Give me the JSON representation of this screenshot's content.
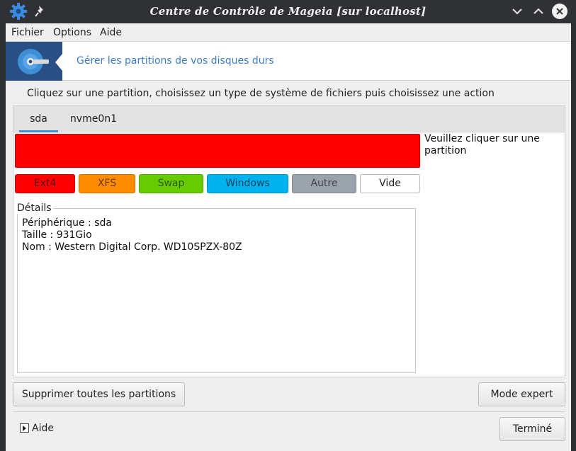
{
  "window": {
    "title": "Centre de Contrôle de Mageia [sur localhost]"
  },
  "menu": {
    "items": [
      "Fichier",
      "Options",
      "Aide"
    ]
  },
  "banner": {
    "text": "Gérer les partitions de vos disques durs"
  },
  "instruction": "Cliquez sur une partition, choisissez un type de système de fichiers puis choisissez une action",
  "tabs": [
    {
      "label": "sda",
      "active": true
    },
    {
      "label": "nvme0n1",
      "active": false
    }
  ],
  "disk": {
    "bar_color": "#ff0000",
    "hint": "Veuillez cliquer sur une partition"
  },
  "fs_types": [
    {
      "label": "Ext4",
      "bg": "#ff0000",
      "fg": "#5a0000"
    },
    {
      "label": "XFS",
      "bg": "#ff8c00",
      "fg": "#6b3a00"
    },
    {
      "label": "Swap",
      "bg": "#66cc00",
      "fg": "#2d5a00"
    },
    {
      "label": "Windows",
      "bg": "#00b2ee",
      "fg": "#00425a"
    },
    {
      "label": "Autre",
      "bg": "#9aa3ab",
      "fg": "#3d4348"
    },
    {
      "label": "Vide",
      "bg": "#ffffff",
      "fg": "#222222"
    }
  ],
  "details": {
    "label": "Détails",
    "lines": [
      "Périphérique : sda",
      "Taille : 931Gio",
      "Nom : Western Digital Corp. WD10SPZX-80Z"
    ]
  },
  "buttons": {
    "delete_all": "Supprimer toutes les partitions",
    "expert": "Mode expert",
    "help": "Aide",
    "done": "Terminé"
  },
  "colors": {
    "banner_logo": "#2a4f85",
    "accent": "#3d8fd6",
    "link": "#3c7ec4"
  },
  "icons": {
    "app": "gear-icon",
    "pin": "pin-icon",
    "minimize": "chevron-down-icon",
    "maximize": "chevron-up-icon",
    "close": "close-icon",
    "logo": "disk-icon"
  }
}
